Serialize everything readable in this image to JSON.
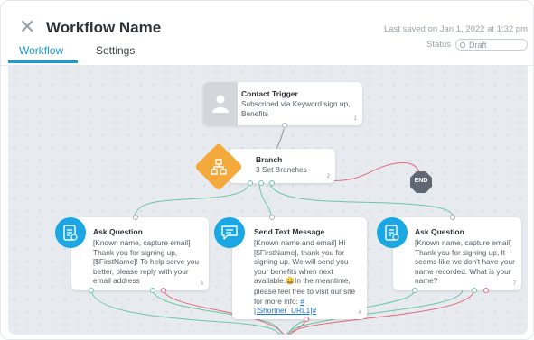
{
  "header": {
    "title": "Workflow Name",
    "last_saved": "Last saved on Jan 1, 2022 at 1:32 pm",
    "status_label": "Status",
    "status_value": "Draft"
  },
  "tabs": [
    {
      "label": "Workflow",
      "active": true
    },
    {
      "label": "Settings",
      "active": false
    }
  ],
  "nodes": {
    "trigger": {
      "title": "Contact Trigger",
      "body": "Subscribed via Keyword sign up, Benefits",
      "number": "1"
    },
    "branch": {
      "title": "Branch",
      "body": "3 Set Branches",
      "number": "2"
    },
    "end": {
      "label": "END"
    },
    "ask1": {
      "title": "Ask Question",
      "body": "[Known name, capture email] Thank you for signing up, [$FirstName]! To help serve you better, please reply with your email address",
      "number": "6"
    },
    "sms": {
      "title": "Send Text Message",
      "body_before": "[Known name and email] Hi [$FirstName], thank you for signing up. We will send you your benefits when next available.",
      "emoji": "😀",
      "body_after": "In the meantime, please feel free to visit our site for more info: ",
      "link": "#[:Shortner_URL1]#",
      "number": "4"
    },
    "ask2": {
      "title": "Ask Question",
      "body": "[Known name, capture email] Thank you for signing up, It seems like we don't have your name recorded. What is your name?",
      "number": "7"
    }
  },
  "colors": {
    "accent": "#1a9ad6",
    "branch": "#f3a93c",
    "end": "#5f6872",
    "path_green": "#6cc6a5",
    "path_red": "#e46a7a"
  },
  "icons": {
    "close": "close-icon",
    "trigger": "person-icon",
    "branch": "branch-icon",
    "ask": "question-form-icon",
    "sms": "chat-message-icon"
  }
}
